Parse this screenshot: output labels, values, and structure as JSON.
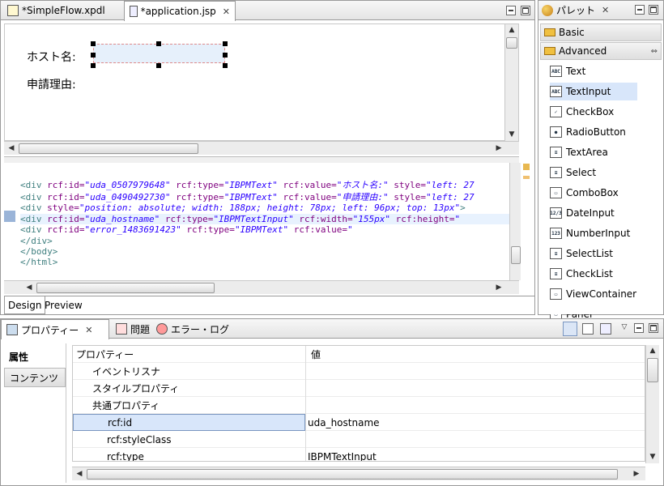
{
  "editor": {
    "tabs": [
      {
        "label": "*SimpleFlow.xpdl",
        "icon": "xpdl-file-icon"
      },
      {
        "label": "*application.jsp",
        "icon": "jsp-file-icon"
      }
    ],
    "design": {
      "labels": [
        "ホスト名:",
        "申請理由:"
      ]
    },
    "code_lines": [
      {
        "tag": "<div ",
        "a1": "rcf:id=",
        "v1": "\"uda_0507979648\"",
        "a2": " rcf:type=",
        "v2": "\"IBPMText\"",
        "a3": " rcf:value=",
        "v3": "\"ホスト名:\"",
        "a4": " style=",
        "v4": "\"left: 27"
      },
      {
        "tag": "<div ",
        "a1": "rcf:id=",
        "v1": "\"uda_0490492730\"",
        "a2": " rcf:type=",
        "v2": "\"IBPMText\"",
        "a3": " rcf:value=",
        "v3": "\"申請理由:\"",
        "a4": " style=",
        "v4": "\"left: 27"
      },
      {
        "tag": "<div ",
        "a1": "style=",
        "v1": "\"position: absolute; width: 188px; height: 78px; left: 96px; top: 13px\"",
        "a2": "",
        "v2": "",
        "a3": "",
        "v3": "",
        "a4": "",
        "v4": "",
        "tail": ">"
      },
      {
        "tag": "    <div ",
        "a1": "rcf:id=",
        "v1": "\"uda_hostname\"",
        "a2": " rcf:type=",
        "v2": "\"IBPMTextInput\"",
        "a3": " rcf:width=",
        "v3": "\"155px\"",
        "a4": " rcf:height=",
        "v4": "\""
      },
      {
        "tag": "    <div ",
        "a1": "rcf:id=",
        "v1": "\"error_1483691423\"",
        "a2": " rcf:type=",
        "v2": "\"IBPMText\"",
        "a3": " rcf:value=",
        "v3": "\"",
        "a4": "",
        "v4": ""
      },
      {
        "tag": "</div>",
        "a1": "",
        "v1": "",
        "a2": "",
        "v2": "",
        "a3": "",
        "v3": "",
        "a4": "",
        "v4": ""
      },
      {
        "tag": "</body>",
        "a1": "",
        "v1": "",
        "a2": "",
        "v2": "",
        "a3": "",
        "v3": "",
        "a4": "",
        "v4": ""
      },
      {
        "tag": "</html>",
        "a1": "",
        "v1": "",
        "a2": "",
        "v2": "",
        "a3": "",
        "v3": "",
        "a4": "",
        "v4": ""
      }
    ],
    "bottom_tabs": [
      "Design",
      "Preview"
    ]
  },
  "palette": {
    "title": "パレット",
    "drawers": [
      "Basic",
      "Advanced"
    ],
    "items": [
      {
        "label": "Text",
        "icon": "ABC"
      },
      {
        "label": "TextInput",
        "icon": "ABC"
      },
      {
        "label": "CheckBox",
        "icon": "✓"
      },
      {
        "label": "RadioButton",
        "icon": "●"
      },
      {
        "label": "TextArea",
        "icon": "≡"
      },
      {
        "label": "Select",
        "icon": "≡"
      },
      {
        "label": "ComboBox",
        "icon": "▭"
      },
      {
        "label": "DateInput",
        "icon": "12/3"
      },
      {
        "label": "NumberInput",
        "icon": "123"
      },
      {
        "label": "SelectList",
        "icon": "≡"
      },
      {
        "label": "CheckList",
        "icon": "≡"
      },
      {
        "label": "ViewContainer",
        "icon": "▭"
      },
      {
        "label": "Panel",
        "icon": "▭"
      }
    ],
    "selected_index": 1
  },
  "properties": {
    "tabs": [
      "プロパティー",
      "問題",
      "エラー・ログ"
    ],
    "side_tabs": [
      "属性",
      "コンテンツ"
    ],
    "columns": [
      "プロパティー",
      "値"
    ],
    "rows": [
      {
        "name": "イベントリスナ",
        "value": "",
        "indent": 1
      },
      {
        "name": "スタイルプロパティ",
        "value": "",
        "indent": 1
      },
      {
        "name": "共通プロパティ",
        "value": "",
        "indent": 1
      },
      {
        "name": "rcf:id",
        "value": "uda_hostname",
        "indent": 2,
        "selected": true
      },
      {
        "name": "rcf:styleClass",
        "value": "",
        "indent": 2
      },
      {
        "name": "rcf:type",
        "value": "IBPMTextInput",
        "indent": 2
      }
    ]
  },
  "colors": {
    "accent_selection": "#d8e6fa",
    "code_tag": "#3f7f7f",
    "code_attr": "#7f007f",
    "code_value": "#2a00ff"
  }
}
